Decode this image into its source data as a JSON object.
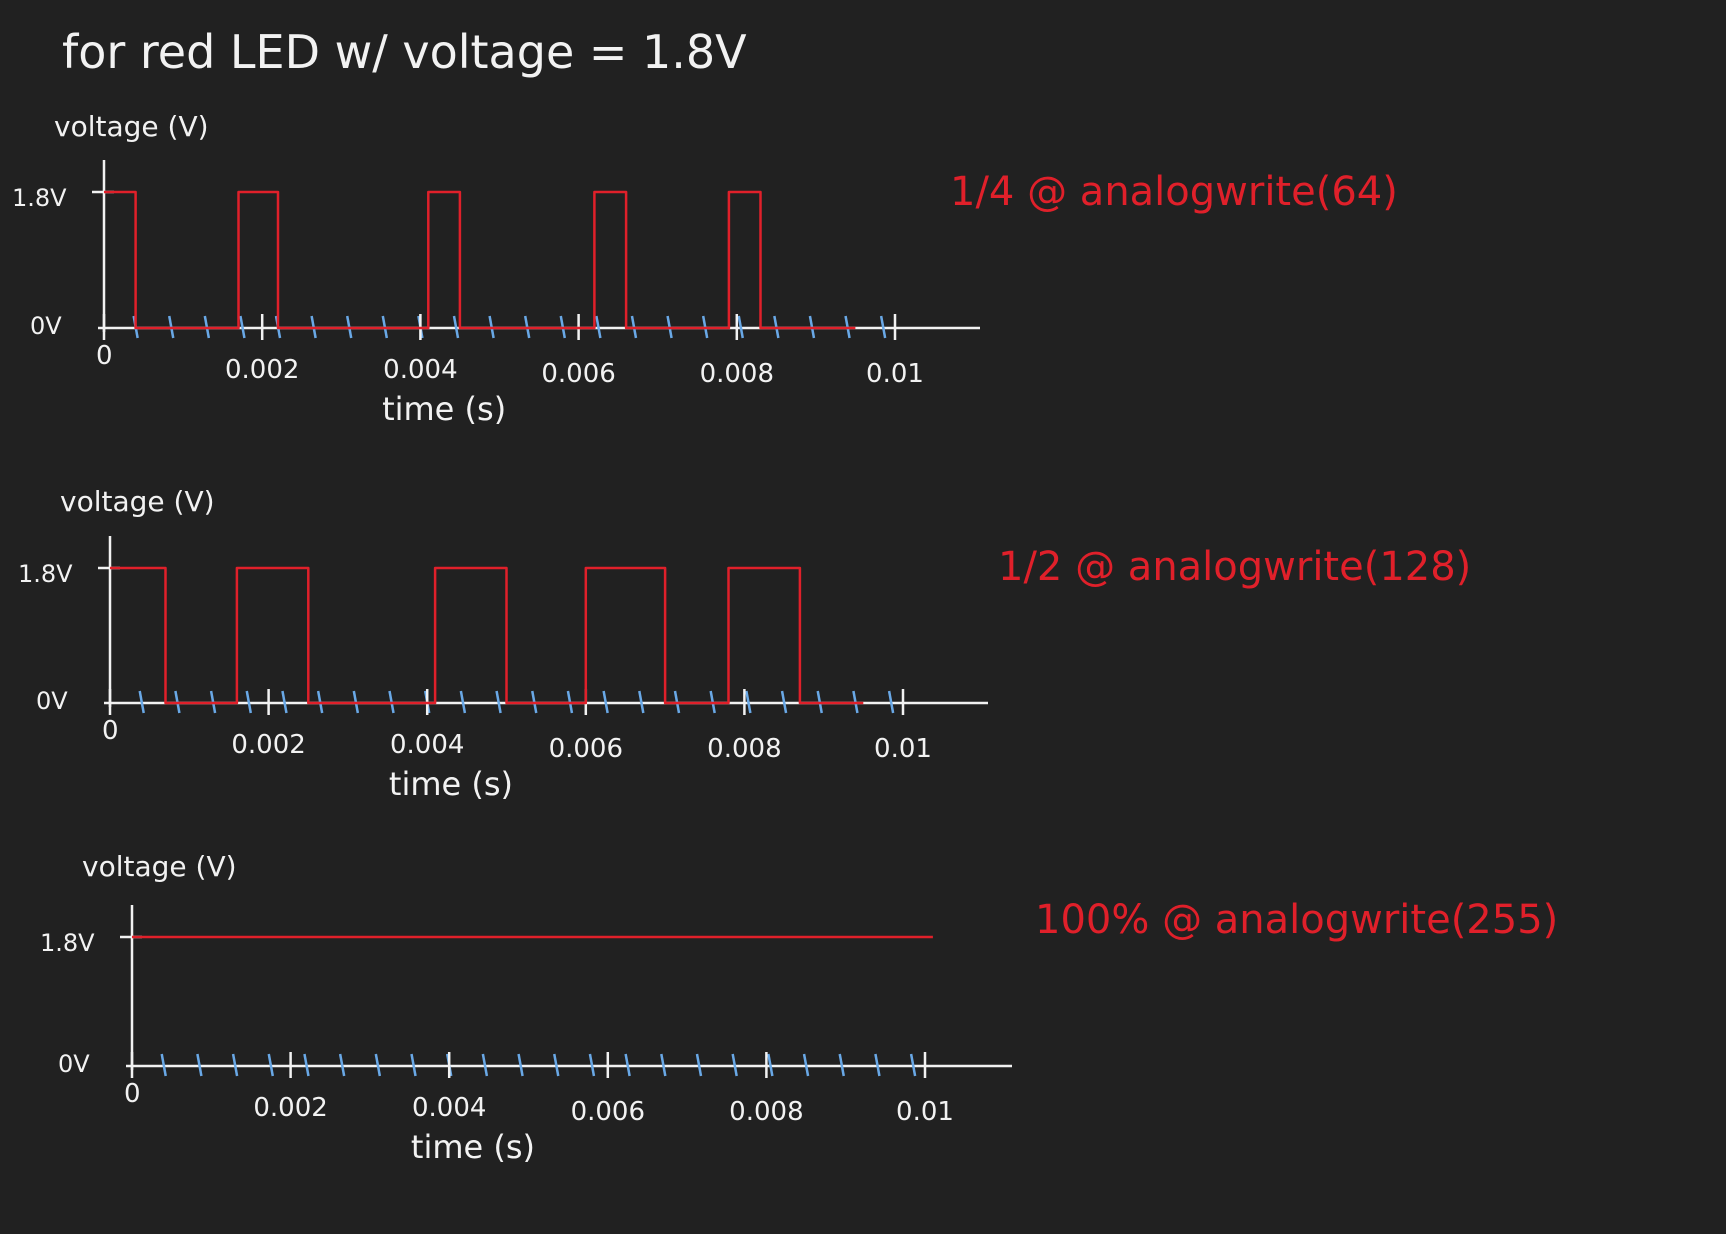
{
  "title": "for red LED w/ voltage = 1.8V",
  "colors": {
    "background": "#212121",
    "ink": "#f2f2f2",
    "signal": "#e0202a",
    "tick": "#69a8e6"
  },
  "chart_data": [
    {
      "type": "line",
      "ylabel": "voltage (V)",
      "xlabel": "time (s)",
      "y_ticks": [
        "0V",
        "1.8V"
      ],
      "x_ticks": [
        "0",
        "0.002",
        "0.004",
        "0.006",
        "0.008",
        "0.01"
      ],
      "x_tick_values": [
        0,
        0.002,
        0.004,
        0.006,
        0.008,
        0.01
      ],
      "ylim": [
        0,
        1.8
      ],
      "xlim": [
        0,
        0.01
      ],
      "annotation": "1/4 @ analogwrite(64)",
      "series": [
        {
          "x": [
            0,
            0.0004,
            0.0004,
            0.0017,
            0.0017,
            0.0022,
            0.0022,
            0.0041,
            0.0041,
            0.0045,
            0.0045,
            0.0062,
            0.0062,
            0.0066,
            0.0066,
            0.0079,
            0.0079,
            0.0083,
            0.0083,
            0.0095
          ],
          "y": [
            1.8,
            1.8,
            0,
            0,
            1.8,
            1.8,
            0,
            0,
            1.8,
            1.8,
            0,
            0,
            1.8,
            1.8,
            0,
            0,
            1.8,
            1.8,
            0,
            0
          ]
        }
      ]
    },
    {
      "type": "line",
      "ylabel": "voltage (V)",
      "xlabel": "time (s)",
      "y_ticks": [
        "0V",
        "1.8V"
      ],
      "x_ticks": [
        "0",
        "0.002",
        "0.004",
        "0.006",
        "0.008",
        "0.01"
      ],
      "x_tick_values": [
        0,
        0.002,
        0.004,
        0.006,
        0.008,
        0.01
      ],
      "ylim": [
        0,
        1.8
      ],
      "xlim": [
        0,
        0.01
      ],
      "annotation": "1/2 @ analogwrite(128)",
      "series": [
        {
          "x": [
            0,
            0.0007,
            0.0007,
            0.0016,
            0.0016,
            0.0025,
            0.0025,
            0.0041,
            0.0041,
            0.005,
            0.005,
            0.006,
            0.006,
            0.007,
            0.007,
            0.0078,
            0.0078,
            0.0087,
            0.0087,
            0.0095
          ],
          "y": [
            1.8,
            1.8,
            0,
            0,
            1.8,
            1.8,
            0,
            0,
            1.8,
            1.8,
            0,
            0,
            1.8,
            1.8,
            0,
            0,
            1.8,
            1.8,
            0,
            0
          ]
        }
      ]
    },
    {
      "type": "line",
      "ylabel": "voltage (V)",
      "xlabel": "time (s)",
      "y_ticks": [
        "0V",
        "1.8V"
      ],
      "x_ticks": [
        "0",
        "0.002",
        "0.004",
        "0.006",
        "0.008",
        "0.01"
      ],
      "x_tick_values": [
        0,
        0.002,
        0.004,
        0.006,
        0.008,
        0.01
      ],
      "ylim": [
        0,
        1.8
      ],
      "xlim": [
        0,
        0.01
      ],
      "annotation": "100% @ analogwrite(255)",
      "series": [
        {
          "x": [
            0,
            0.0101
          ],
          "y": [
            1.8,
            1.8
          ]
        }
      ]
    }
  ]
}
